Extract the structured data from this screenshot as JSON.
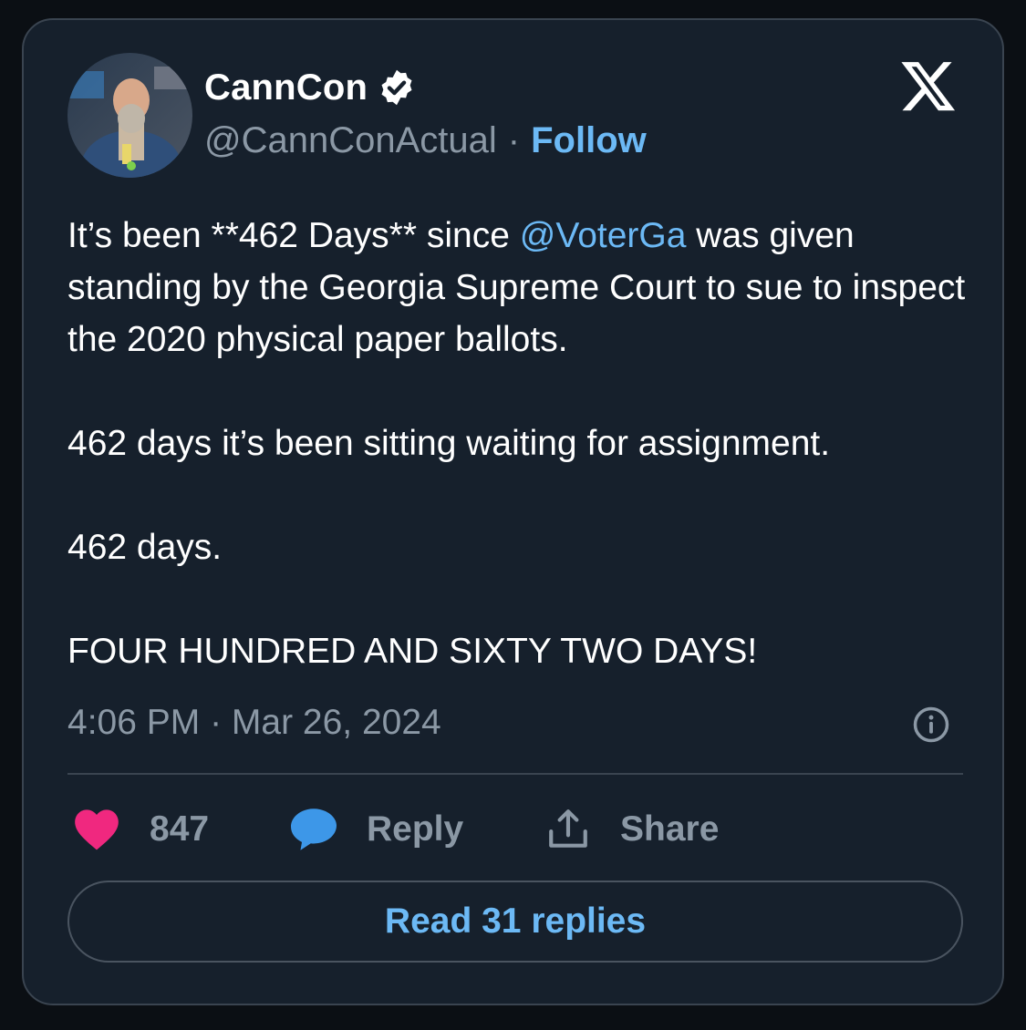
{
  "author": {
    "name": "CannCon",
    "handle": "@CannConActual",
    "separator": "·",
    "follow_label": "Follow",
    "verified_icon": "verified-badge-icon"
  },
  "post": {
    "line1_pre": "It’s been **462 Days** since ",
    "mention": "@VoterGa",
    "line1_post": " was given standing by the Georgia Supreme Court to sue to inspect the 2020 physical paper ballots.",
    "para2": "462 days it’s been sitting waiting for assignment.",
    "para3": "462 days.",
    "para4": "FOUR HUNDRED AND SIXTY TWO DAYS!"
  },
  "timestamp": "4:06 PM · Mar 26, 2024",
  "actions": {
    "likes": "847",
    "reply_label": "Reply",
    "share_label": "Share"
  },
  "read_replies_label": "Read 31 replies",
  "colors": {
    "accent": "#6cb9f5",
    "like": "#f0287f",
    "reply_icon": "#3d97e8",
    "background": "#16202c"
  }
}
